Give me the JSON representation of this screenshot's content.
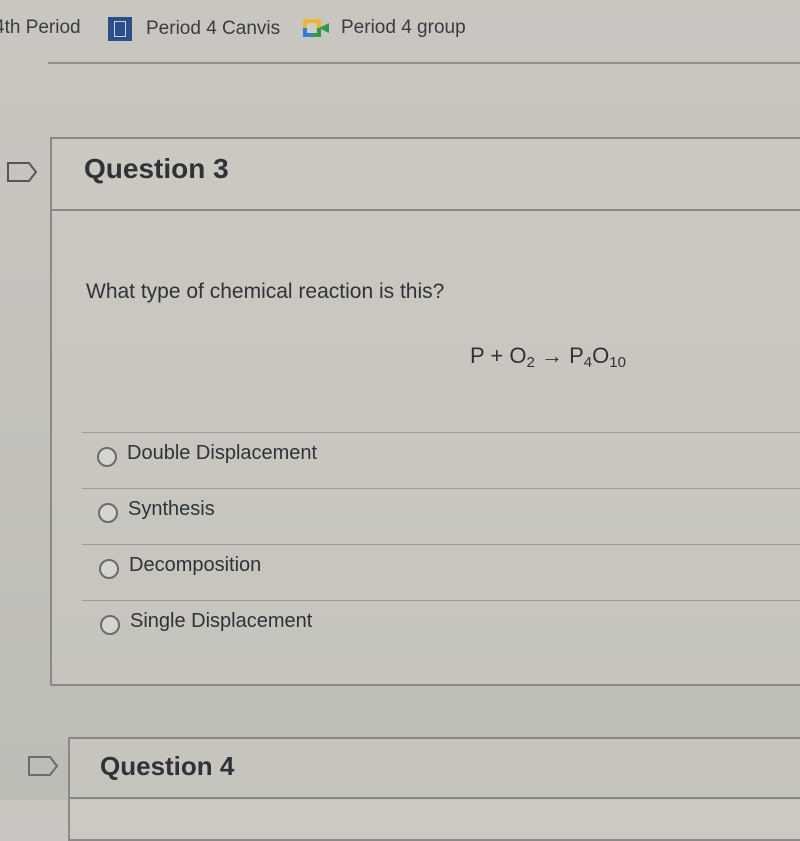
{
  "bookmarks": [
    {
      "label": "4th Period",
      "icon": "none"
    },
    {
      "label": "Period 4 Canvis",
      "icon": "canvas-icon"
    },
    {
      "label": "Period 4 group",
      "icon": "google-meet-icon"
    }
  ],
  "questions": [
    {
      "title": "Question 3",
      "prompt": "What type of chemical reaction is this?",
      "equation": {
        "reactant1": "P",
        "plus": "+",
        "reactant2": "O",
        "reactant2_sub": "2",
        "arrow": "→",
        "product_p": "P",
        "product_p_sub": "4",
        "product_o": "O",
        "product_o_sub": "10"
      },
      "answers": [
        "Double Displacement",
        "Synthesis",
        "Decomposition",
        "Single Displacement"
      ],
      "selected": null
    },
    {
      "title": "Question 4"
    }
  ]
}
